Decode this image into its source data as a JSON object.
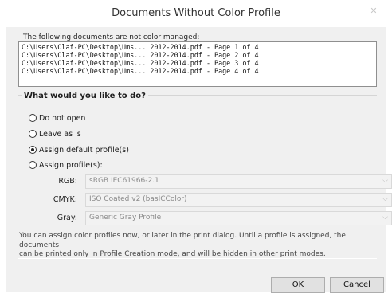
{
  "window": {
    "title": "Documents Without Color Profile"
  },
  "documents": {
    "label": "The following documents are not color managed:",
    "items": [
      "C:\\Users\\Olaf-PC\\Desktop\\Ums... 2012-2014.pdf - Page 1 of 4",
      "C:\\Users\\Olaf-PC\\Desktop\\Ums... 2012-2014.pdf - Page 2 of 4",
      "C:\\Users\\Olaf-PC\\Desktop\\Ums... 2012-2014.pdf - Page 3 of 4",
      "C:\\Users\\Olaf-PC\\Desktop\\Ums... 2012-2014.pdf - Page 4 of 4"
    ]
  },
  "options": {
    "heading": "What would you like to do?",
    "choices": [
      {
        "label": "Do not open",
        "selected": false
      },
      {
        "label": "Leave as is",
        "selected": false
      },
      {
        "label": "Assign default profile(s)",
        "selected": true
      },
      {
        "label": "Assign profile(s):",
        "selected": false
      }
    ]
  },
  "profiles": {
    "rgb": {
      "label": "RGB:",
      "value": "sRGB IEC61966-2.1"
    },
    "cmyk": {
      "label": "CMYK:",
      "value": "ISO Coated v2 (basICColor)"
    },
    "gray": {
      "label": "Gray:",
      "value": "Generic Gray Profile"
    }
  },
  "info_lines": [
    "You can assign color profiles now, or later in the print dialog. Until a profile is assigned, the documents",
    "can be printed only in Profile Creation mode, and will be hidden in other print modes."
  ],
  "buttons": {
    "ok": "OK",
    "cancel": "Cancel"
  }
}
